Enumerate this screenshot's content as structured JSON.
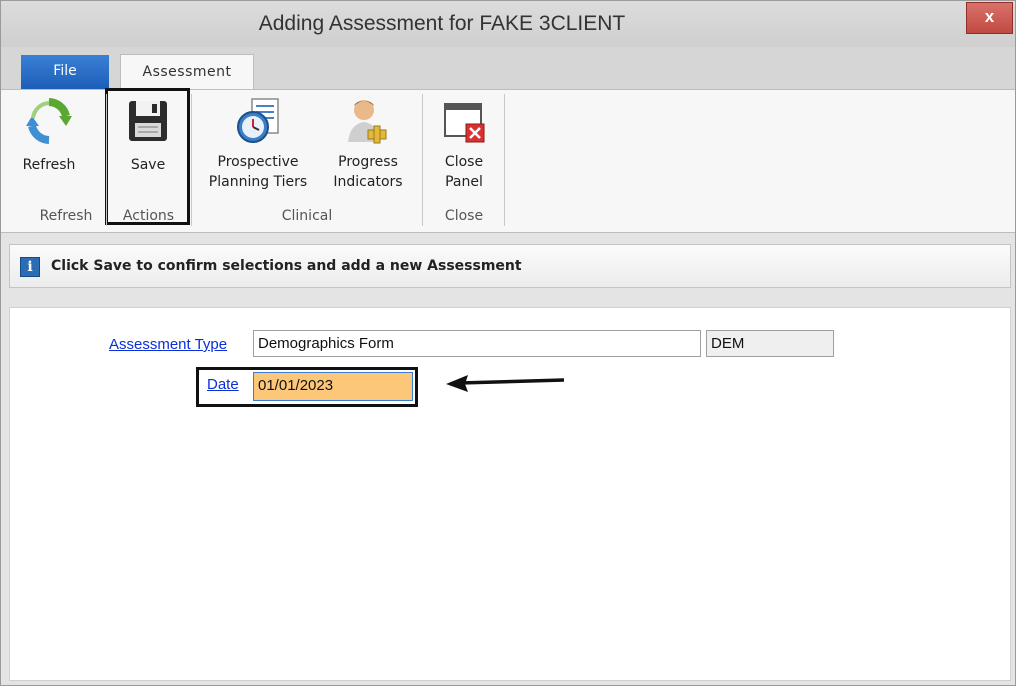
{
  "window": {
    "title": "Adding Assessment for FAKE 3CLIENT",
    "close_label": "x"
  },
  "tabs": {
    "file": "File",
    "assessment": "Assessment"
  },
  "ribbon": {
    "refresh": {
      "label": "Refresh",
      "icon": "refresh-icon"
    },
    "save": {
      "label": "Save",
      "icon": "floppy-disk-icon"
    },
    "prospective": {
      "label_line1": "Prospective",
      "label_line2": "Planning Tiers",
      "icon": "clock-document-icon"
    },
    "progress": {
      "label_line1": "Progress",
      "label_line2": "Indicators",
      "icon": "person-key-icon"
    },
    "close_panel": {
      "label_line1": "Close",
      "label_line2": "Panel",
      "icon": "close-panel-icon"
    },
    "groups": {
      "refresh": "Refresh",
      "actions": "Actions",
      "clinical": "Clinical",
      "close": "Close"
    }
  },
  "info": {
    "icon": "info-icon",
    "message": "Click Save to confirm selections and add a new Assessment"
  },
  "form": {
    "assessment_type_label": "Assessment Type",
    "assessment_type_value": "Demographics Form",
    "assessment_type_code": "DEM",
    "date_label": "Date",
    "date_value": "01/01/2023"
  },
  "colors": {
    "file_tab": "#1d5fb8",
    "close_button": "#c04a42",
    "date_field_bg": "#fdc77a",
    "link": "#0b2fd8"
  }
}
